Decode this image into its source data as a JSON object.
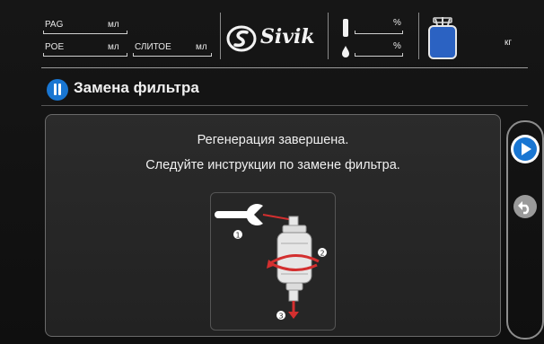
{
  "header": {
    "pag_label": "PAG",
    "pag_unit": "мл",
    "poe_label": "POE",
    "poe_unit": "мл",
    "drain_label": "СЛИТОЕ",
    "drain_unit": "мл",
    "percent_1": "%",
    "percent_2": "%",
    "weight_unit": "кг",
    "brand": "Sivik"
  },
  "page": {
    "title": "Замена фильтра"
  },
  "content": {
    "line_1": "Регенерация завершена.",
    "line_2": "Следуйте инструкции по замене фильтра.",
    "step_1": "1",
    "step_2": "2",
    "step_3": "3"
  },
  "sidebar": {
    "next_icon": "play-icon",
    "back_icon": "undo-icon"
  },
  "colors": {
    "accent_blue": "#1976d2",
    "tank_blue": "#2b62c2",
    "arrow_red": "#d32f2f"
  }
}
